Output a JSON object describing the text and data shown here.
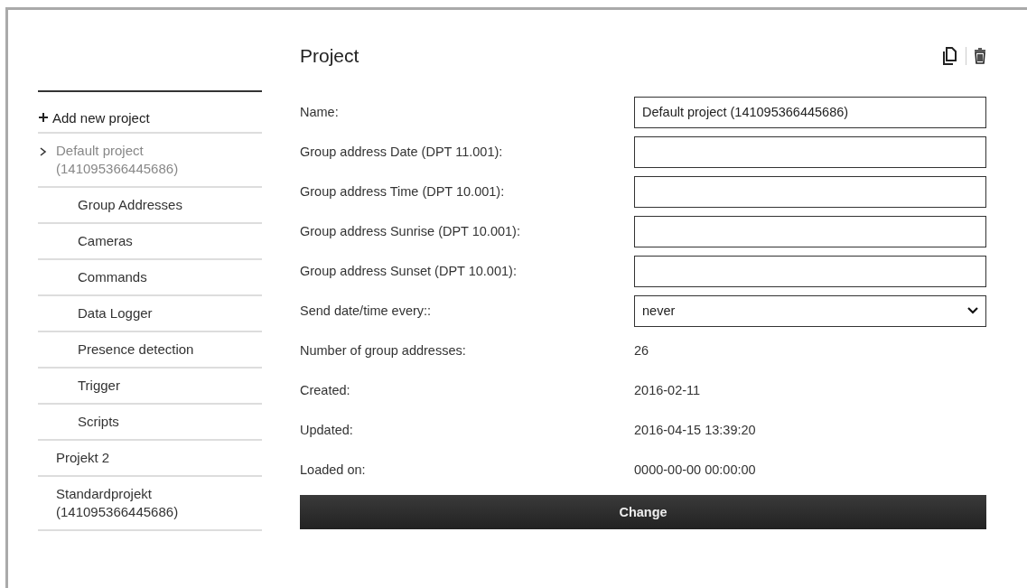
{
  "sidebar": {
    "add_label": "Add new project",
    "projects": [
      {
        "label": "Default project (141095366445686)",
        "selected": true,
        "expanded": true,
        "children": [
          {
            "label": "Group Addresses"
          },
          {
            "label": "Cameras"
          },
          {
            "label": "Commands"
          },
          {
            "label": "Data Logger"
          },
          {
            "label": "Presence detection"
          },
          {
            "label": "Trigger"
          },
          {
            "label": "Scripts"
          }
        ]
      },
      {
        "label": "Projekt 2",
        "selected": false,
        "expanded": false
      },
      {
        "label": "Standardprojekt (141095366445686)",
        "selected": false,
        "expanded": false
      }
    ]
  },
  "main": {
    "title": "Project",
    "fields": [
      {
        "kind": "input",
        "label": "Name:",
        "value": "Default project (141095366445686)"
      },
      {
        "kind": "input",
        "label": "Group address Date (DPT 11.001):"
      },
      {
        "kind": "input",
        "label": "Group address Time (DPT 10.001):"
      },
      {
        "kind": "input",
        "label": "Group address Sunrise (DPT 10.001):"
      },
      {
        "kind": "input",
        "label": "Group address Sunset (DPT 10.001):"
      },
      {
        "kind": "select",
        "label": "Send date/time every::",
        "value": "never"
      },
      {
        "kind": "info",
        "label": "Number of group addresses:",
        "value": "26"
      },
      {
        "kind": "info",
        "label": "Created:",
        "value": "2016-02-11"
      },
      {
        "kind": "info",
        "label": "Updated:",
        "value": "2016-04-15 13:39:20"
      },
      {
        "kind": "info",
        "label": "Loaded on:",
        "value": "0000-00-00 00:00:00"
      }
    ],
    "submit_label": "Change"
  }
}
